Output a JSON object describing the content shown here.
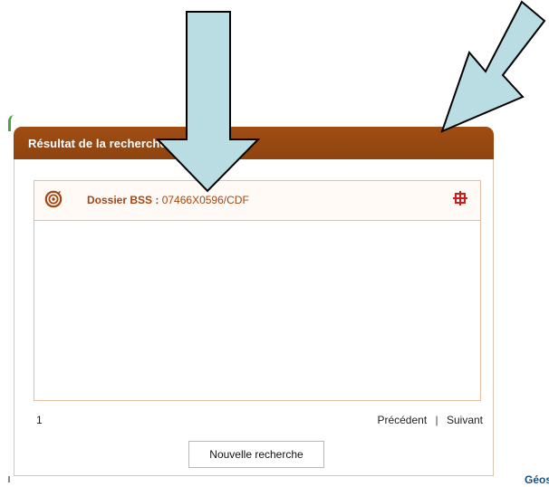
{
  "panel": {
    "title": "Résultat de la recherche"
  },
  "results": {
    "items": [
      {
        "prefix": "Dossier BSS : ",
        "code": "07466X0596/CDF",
        "icon": "bss-dossier-icon",
        "locate_icon": "locate-target-icon"
      }
    ],
    "page": "1",
    "previous_label": "Précédent",
    "separator": "|",
    "next_label": "Suivant"
  },
  "actions": {
    "new_search_label": "Nouvelle recherche"
  },
  "footer": {
    "corner_text": "Géos"
  },
  "colors": {
    "panel_header": "#9a4a12",
    "accent_text": "#a34612",
    "annotation_arrow": "#b9dde3",
    "locate_red": "#d11a1a"
  }
}
